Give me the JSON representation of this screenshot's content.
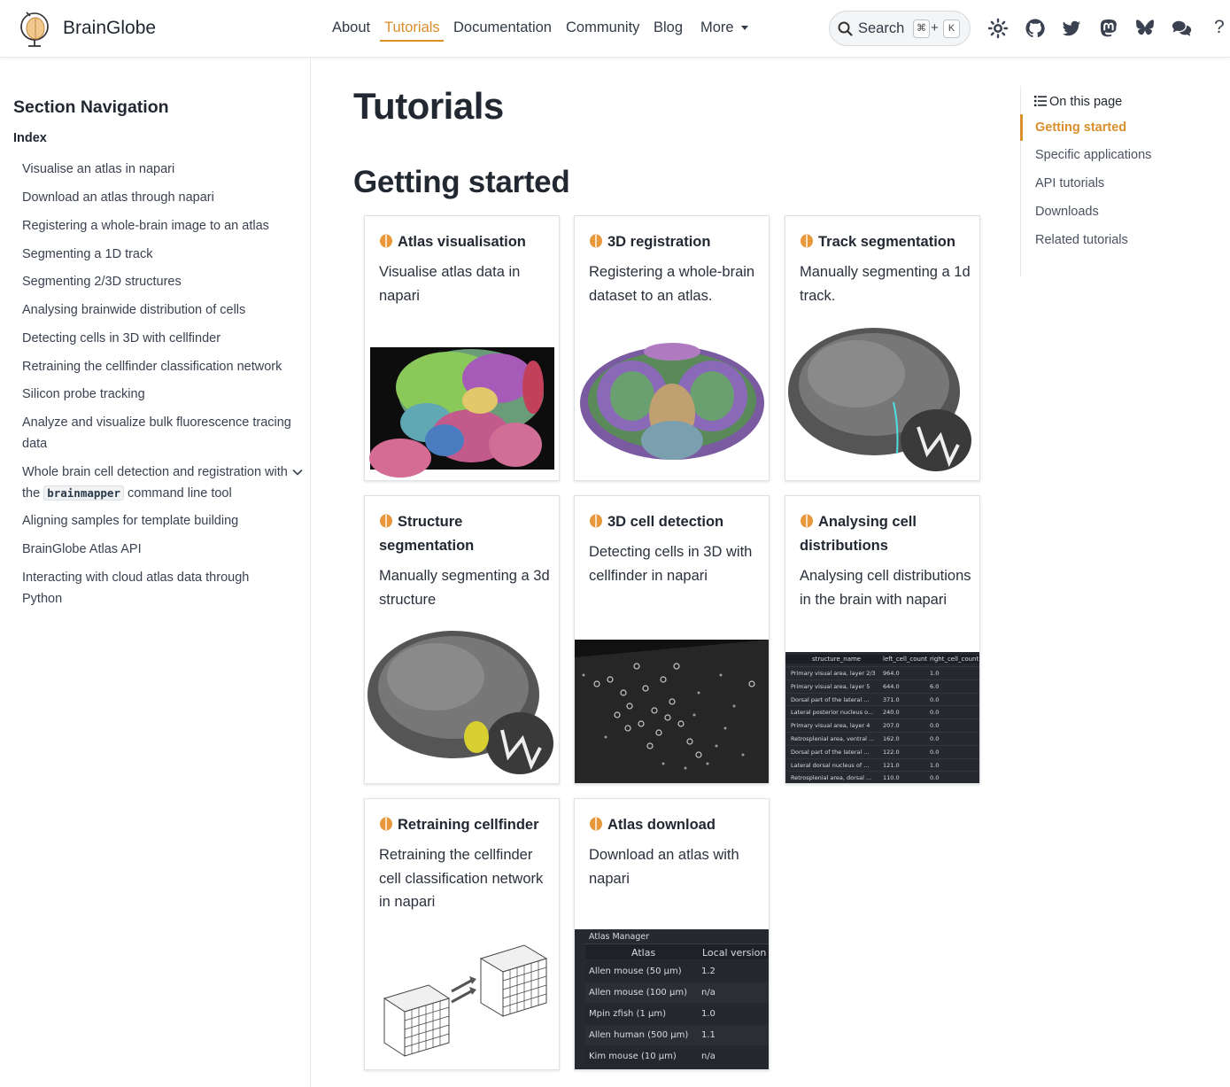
{
  "header": {
    "brand": "BrainGlobe",
    "nav": [
      {
        "label": "About"
      },
      {
        "label": "Tutorials"
      },
      {
        "label": "Documentation"
      },
      {
        "label": "Community"
      },
      {
        "label": "Blog"
      },
      {
        "label": "More"
      }
    ],
    "search": {
      "label": "Search",
      "key1": "⌘",
      "plus": "+",
      "key2": "K"
    },
    "icons": [
      "theme-icon",
      "github-icon",
      "twitter-icon",
      "mastodon-icon",
      "bluesky-icon",
      "chat-icon",
      "help-icon"
    ],
    "help_glyph": "?"
  },
  "sidebar": {
    "title": "Section Navigation",
    "index": "Index",
    "items": [
      {
        "label": "Visualise an atlas in napari"
      },
      {
        "label": "Download an atlas through napari"
      },
      {
        "label": "Registering a whole-brain image to an atlas"
      },
      {
        "label": "Segmenting a 1D track"
      },
      {
        "label": "Segmenting 2/3D structures"
      },
      {
        "label": "Analysing brainwide distribution of cells"
      },
      {
        "label": "Detecting cells in 3D with cellfinder"
      },
      {
        "label": "Retraining the cellfinder classification network"
      },
      {
        "label": "Silicon probe tracking"
      },
      {
        "label": "Analyze and visualize bulk fluorescence tracing data"
      },
      {
        "label_pre": "Whole brain cell detection and registration with the",
        "code": "brainmapper",
        "label_post": "command line tool"
      },
      {
        "label": "Aligning samples for template building"
      },
      {
        "label": "BrainGlobe Atlas API"
      },
      {
        "label": "Interacting with cloud atlas data through Python"
      }
    ]
  },
  "main": {
    "title": "Tutorials",
    "section": "Getting started",
    "cards": [
      {
        "title": "Atlas visualisation",
        "text": "Visualise atlas data in napari"
      },
      {
        "title": "3D registration",
        "text": "Registering a whole-brain dataset to an atlas."
      },
      {
        "title": "Track segmentation",
        "text": "Manually segmenting a 1d track."
      },
      {
        "title": "Structure segmentation",
        "text": "Manually segmenting a 3d structure"
      },
      {
        "title": "3D cell detection",
        "text": "Detecting cells in 3D with cellfinder in napari"
      },
      {
        "title": "Analysing cell distributions",
        "text": "Analysing cell distributions in the brain with napari"
      },
      {
        "title": "Retraining cellfinder",
        "text": "Retraining the cellfinder cell classification network in napari"
      },
      {
        "title": "Atlas download",
        "text": "Download an atlas with napari"
      }
    ],
    "cell_table": {
      "headers": [
        "structure_name",
        "left_cell_count",
        "right_cell_count"
      ],
      "rows": [
        [
          "Primary visual area, layer 2/3",
          "964.0",
          "1.0"
        ],
        [
          "Primary visual area, layer 5",
          "644.0",
          "6.0"
        ],
        [
          "Dorsal part of the lateral ...",
          "371.0",
          "0.0"
        ],
        [
          "Lateral posterior nucleus o...",
          "240.0",
          "0.0"
        ],
        [
          "Primary visual area, layer 4",
          "207.0",
          "0.0"
        ],
        [
          "Retrosplenial area, ventral ...",
          "162.0",
          "0.0"
        ],
        [
          "Dorsal part of the lateral ...",
          "122.0",
          "0.0"
        ],
        [
          "Lateral dorsal nucleus of ...",
          "121.0",
          "1.0"
        ],
        [
          "Retrosplenial area, dorsal ...",
          "110.0",
          "0.0"
        ]
      ]
    },
    "atlas_manager": {
      "title": "Atlas Manager",
      "headers": [
        "Atlas",
        "Local version"
      ],
      "rows": [
        [
          "Allen mouse (50 µm)",
          "1.2"
        ],
        [
          "Allen mouse (100 µm)",
          "n/a"
        ],
        [
          "Mpin zfish (1 µm)",
          "1.0"
        ],
        [
          "Allen human (500 µm)",
          "1.1"
        ],
        [
          "Kim mouse (10 µm)",
          "n/a"
        ]
      ]
    }
  },
  "toc": {
    "heading": "On this page",
    "items": [
      {
        "label": "Getting started"
      },
      {
        "label": "Specific applications"
      },
      {
        "label": "API tutorials"
      },
      {
        "label": "Downloads"
      },
      {
        "label": "Related tutorials"
      }
    ]
  },
  "colors": {
    "accent": "#d98f2b",
    "text": "#222832"
  }
}
